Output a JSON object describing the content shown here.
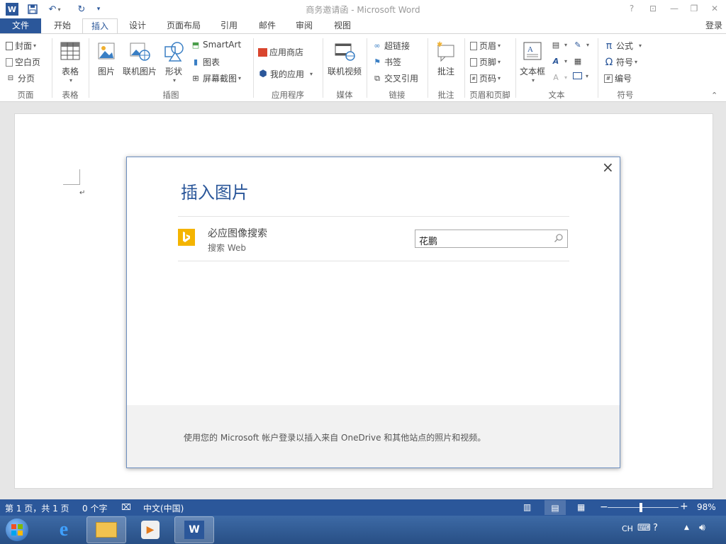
{
  "window": {
    "title": "商务邀请函 - Microsoft Word",
    "help": "?",
    "signin": "登录"
  },
  "tabs": [
    "文件",
    "开始",
    "插入",
    "设计",
    "页面布局",
    "引用",
    "邮件",
    "审阅",
    "视图"
  ],
  "ribbon": {
    "pages": {
      "cover": "封面",
      "blank": "空白页",
      "break": "分页",
      "label": "页面"
    },
    "tables": {
      "table": "表格",
      "label": "表格"
    },
    "illustrations": {
      "picture": "图片",
      "online_picture": "联机图片",
      "shapes": "形状",
      "smartart": "SmartArt",
      "chart": "图表",
      "screenshot": "屏幕截图",
      "label": "插图"
    },
    "apps": {
      "store": "应用商店",
      "my_apps": "我的应用",
      "label": "应用程序"
    },
    "media": {
      "online_video": "联机视频",
      "label": "媒体"
    },
    "links": {
      "hyperlink": "超链接",
      "bookmark": "书签",
      "cross_ref": "交叉引用",
      "label": "链接"
    },
    "comments": {
      "comment": "批注",
      "label": "批注"
    },
    "header_footer": {
      "header": "页眉",
      "footer": "页脚",
      "page_number": "页码",
      "label": "页眉和页脚"
    },
    "text": {
      "textbox": "文本框",
      "label": "文本"
    },
    "symbols": {
      "equation": "公式",
      "symbol": "符号",
      "number": "编号",
      "label": "符号"
    }
  },
  "dialog": {
    "title": "插入图片",
    "source_name": "必应图像搜索",
    "source_sub": "搜索 Web",
    "search_value": "花鹏",
    "footer_text": "使用您的 Microsoft 帐户登录以插入来自 OneDrive 和其他站点的照片和视频。",
    "close": "×"
  },
  "statusbar": {
    "page": "第 1 页，共 1 页",
    "words": "0 个字",
    "language": "中文(中国)",
    "zoom": "98%",
    "zoom_minus": "−",
    "zoom_plus": "+"
  },
  "taskbar": {
    "ime": "CH"
  },
  "colors": {
    "accent": "#2b579a",
    "dialog_title": "#2b579a",
    "bing": "#f4b400"
  }
}
